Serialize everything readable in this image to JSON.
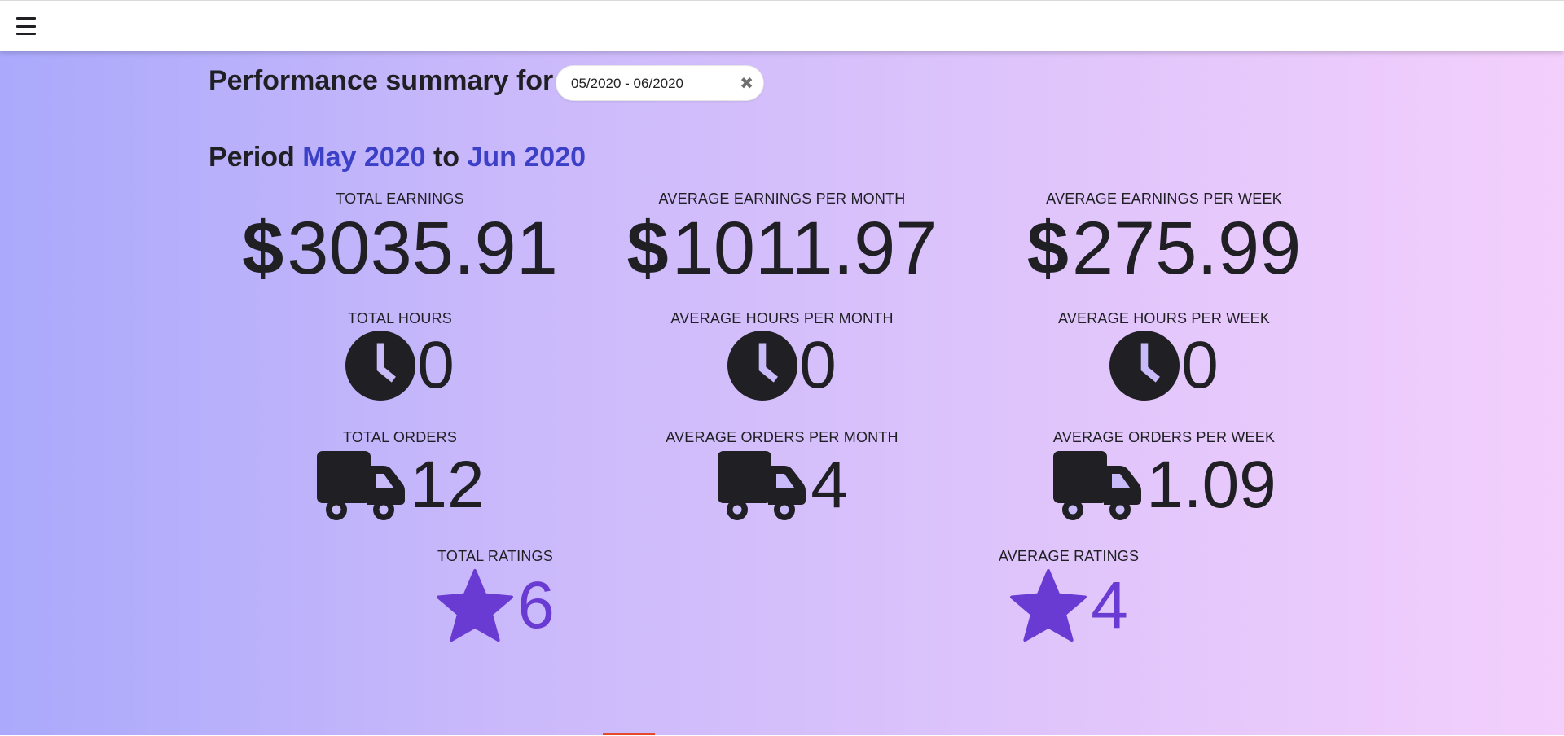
{
  "header": {
    "menu_icon": "hamburger-menu-icon"
  },
  "summary": {
    "title": "Performance summary for",
    "date_range_value": "05/2020 - 06/2020",
    "clear_symbol": "✖"
  },
  "period": {
    "label": "Period",
    "start": "May 2020",
    "connector": "to",
    "end": "Jun 2020"
  },
  "earnings": {
    "currency_symbol": "$",
    "total_label": "TOTAL EARNINGS",
    "total_value": "3035.91",
    "month_label": "AVERAGE EARNINGS PER MONTH",
    "month_value": "1011.97",
    "week_label": "AVERAGE EARNINGS PER WEEK",
    "week_value": "275.99"
  },
  "hours": {
    "icon": "clock-icon",
    "total_label": "TOTAL HOURS",
    "total_value": "0",
    "month_label": "AVERAGE HOURS PER MONTH",
    "month_value": "0",
    "week_label": "AVERAGE HOURS PER WEEK",
    "week_value": "0"
  },
  "orders": {
    "icon": "truck-icon",
    "total_label": "TOTAL ORDERS",
    "total_value": "12",
    "month_label": "AVERAGE ORDERS PER MONTH",
    "month_value": "4",
    "week_label": "AVERAGE ORDERS PER WEEK",
    "week_value": "1.09"
  },
  "ratings": {
    "icon": "star-icon",
    "total_label": "TOTAL RATINGS",
    "total_value": "6",
    "average_label": "AVERAGE RATINGS",
    "average_value": "4"
  },
  "colors": {
    "accent_blue": "#3c40c6",
    "rating_purple": "#6a3bd3",
    "text_dark": "#1f1f24",
    "gradient_start": "#aaa9fb",
    "gradient_end": "#f3cffc"
  }
}
